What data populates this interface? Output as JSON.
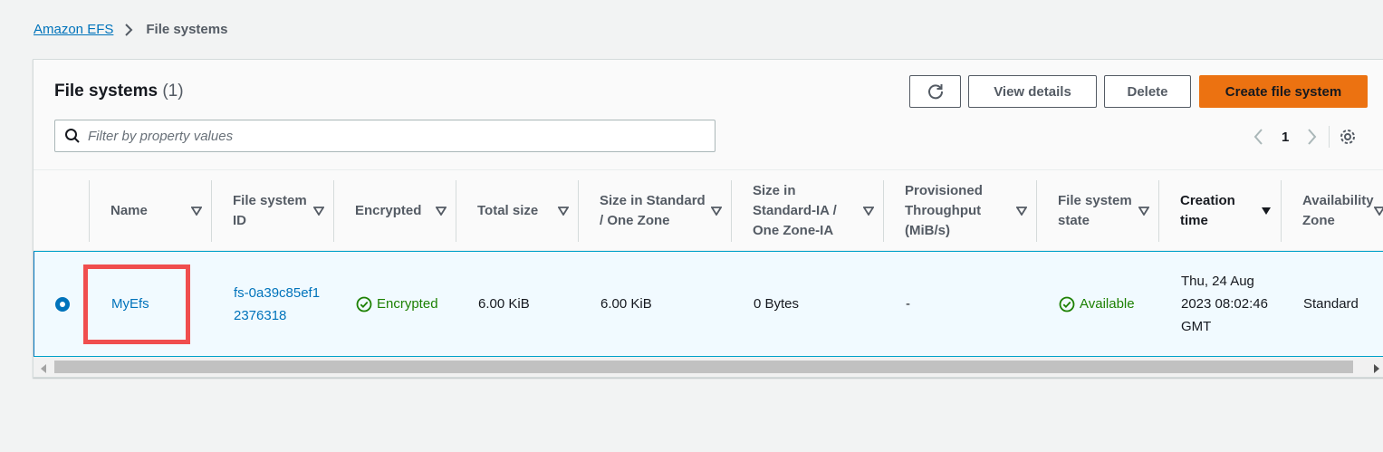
{
  "breadcrumb": {
    "root": "Amazon EFS",
    "current": "File systems"
  },
  "header": {
    "title": "File systems",
    "count": "(1)",
    "view_details": "View details",
    "delete": "Delete",
    "create": "Create file system"
  },
  "filter": {
    "placeholder": "Filter by property values",
    "value": ""
  },
  "pagination": {
    "page": "1"
  },
  "columns": [
    "Name",
    "File system ID",
    "Encrypted",
    "Total size",
    "Size in Standard / One Zone",
    "Size in Standard-IA / One Zone-IA",
    "Provisioned Throughput (MiB/s)",
    "File system state",
    "Creation time",
    "Availability Zone"
  ],
  "rows": [
    {
      "name": "MyEfs",
      "id": "fs-0a39c85ef12376318",
      "encrypted": "Encrypted",
      "total_size": "6.00 KiB",
      "size_standard": "6.00 KiB",
      "size_ia": "0 Bytes",
      "throughput": "-",
      "state": "Available",
      "created": "Thu, 24 Aug 2023 08:02:46 GMT",
      "az": "Standard"
    }
  ],
  "colors": {
    "link": "#0073bb",
    "success": "#1d8102",
    "primary_button": "#ec7211",
    "highlight": "#f04e4e"
  }
}
